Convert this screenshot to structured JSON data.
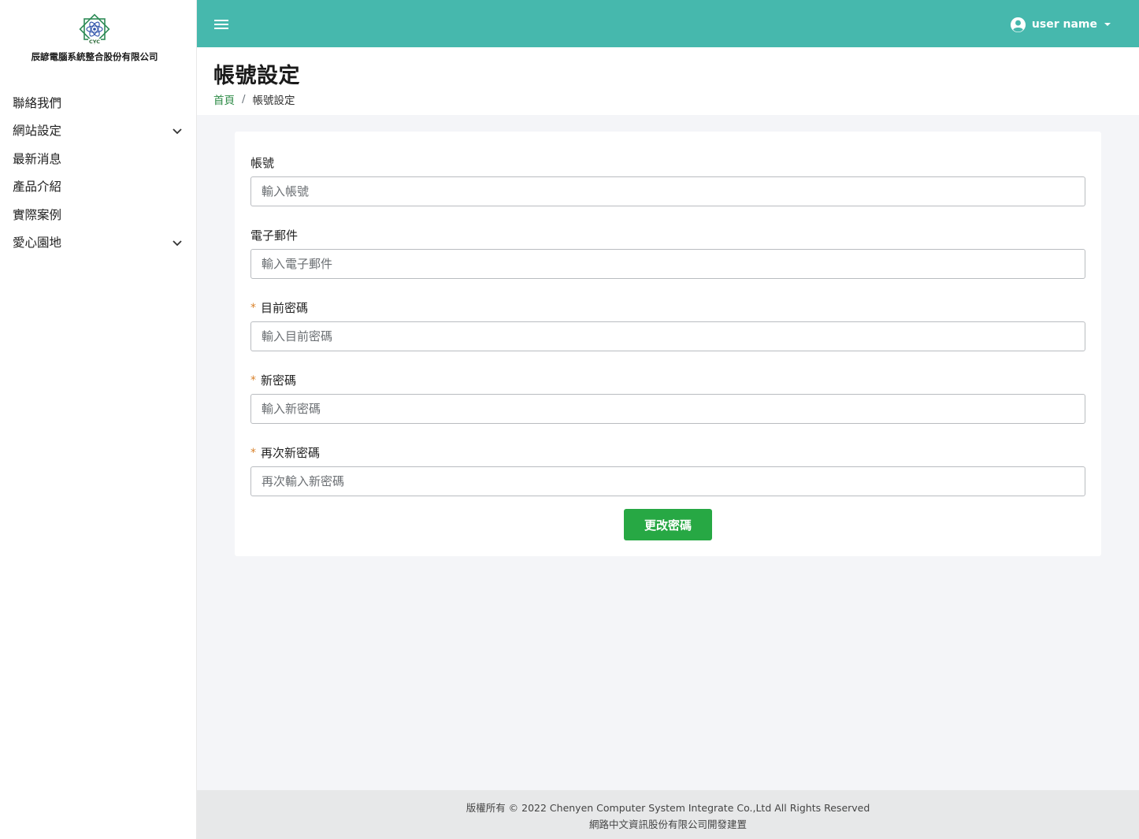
{
  "sidebar": {
    "logo_text": "CYC",
    "company_name": "辰諺電腦系統整合股份有限公司",
    "items": [
      {
        "label": "聯絡我們",
        "has_submenu": false
      },
      {
        "label": "網站設定",
        "has_submenu": true
      },
      {
        "label": "最新消息",
        "has_submenu": false
      },
      {
        "label": "產品介紹",
        "has_submenu": false
      },
      {
        "label": "實際案例",
        "has_submenu": false
      },
      {
        "label": "愛心園地",
        "has_submenu": true
      }
    ]
  },
  "topbar": {
    "user_name": "user name",
    "accent_color": "#46b8ad"
  },
  "header": {
    "title": "帳號設定",
    "breadcrumb": {
      "home": "首頁",
      "separator": "/",
      "current": "帳號設定"
    }
  },
  "form": {
    "account": {
      "label": "帳號",
      "required": false,
      "placeholder": "輸入帳號",
      "value": ""
    },
    "email": {
      "label": "電子郵件",
      "required": false,
      "placeholder": "輸入電子郵件",
      "value": ""
    },
    "current_password": {
      "label": "目前密碼",
      "required": true,
      "placeholder": "輸入目前密碼",
      "value": ""
    },
    "new_password": {
      "label": "新密碼",
      "required": true,
      "placeholder": "輸入新密碼",
      "value": ""
    },
    "confirm_password": {
      "label": "再次新密碼",
      "required": true,
      "placeholder": "再次輸入新密碼",
      "value": ""
    },
    "required_mark": "*",
    "submit_label": "更改密碼",
    "submit_color": "#27a844"
  },
  "footer": {
    "copyright": "版權所有 © 2022 Chenyen Computer System Integrate Co.,Ltd All Rights Reserved",
    "developer": "網路中文資訊股份有限公司開發建置"
  }
}
